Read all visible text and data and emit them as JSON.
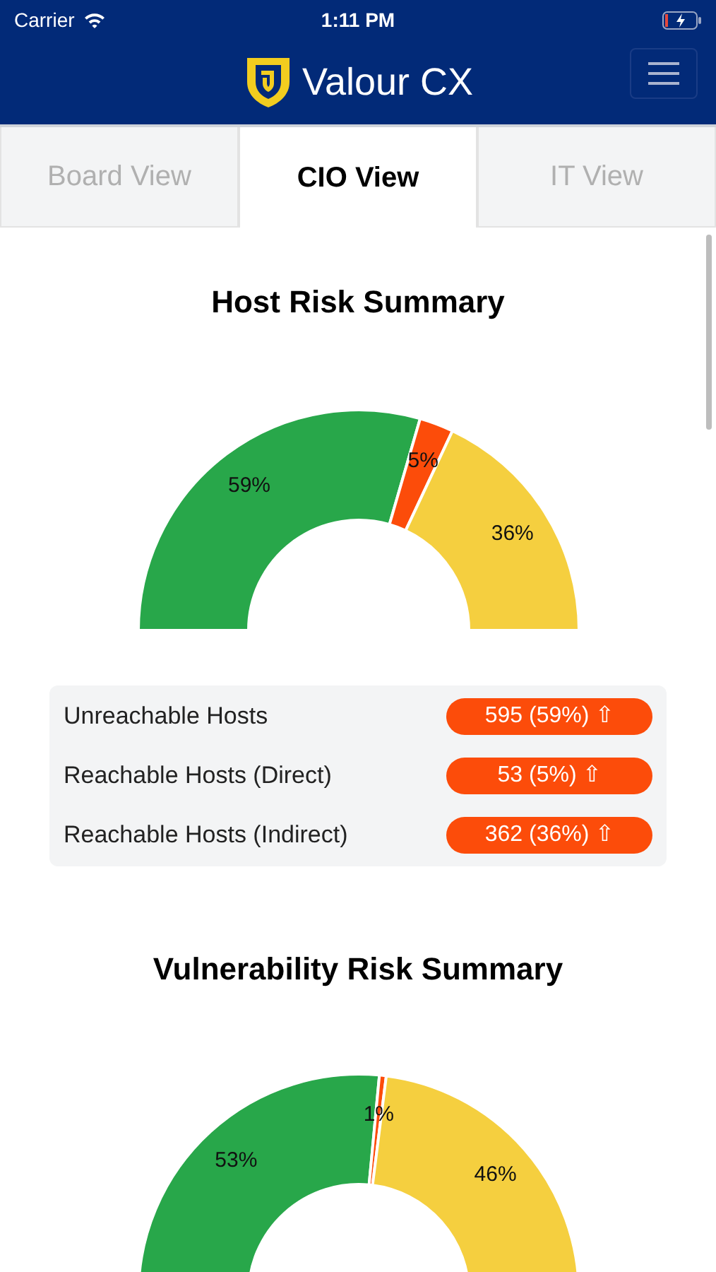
{
  "status_bar": {
    "carrier": "Carrier",
    "time": "1:11 PM"
  },
  "app_bar": {
    "title": "Valour CX"
  },
  "tabs": [
    {
      "label": "Board View",
      "selected": false
    },
    {
      "label": "CIO View",
      "selected": true
    },
    {
      "label": "IT View",
      "selected": false
    }
  ],
  "sections": [
    {
      "title": "Host Risk Summary",
      "chart_data": {
        "type": "donut",
        "values": [
          59,
          5,
          36
        ],
        "value_labels": [
          "59%",
          "5%",
          "36%"
        ]
      },
      "rows": [
        {
          "label": "Unreachable Hosts",
          "badge": "595 (59%) ⇧"
        },
        {
          "label": "Reachable Hosts (Direct)",
          "badge": "53 (5%) ⇧"
        },
        {
          "label": "Reachable Hosts (Indirect)",
          "badge": "362 (36%) ⇧"
        }
      ]
    },
    {
      "title": "Vulnerability Risk Summary",
      "chart_data": {
        "type": "donut",
        "values": [
          53,
          1,
          46
        ],
        "value_labels": [
          "53%",
          "1%",
          "46%"
        ]
      }
    }
  ]
}
